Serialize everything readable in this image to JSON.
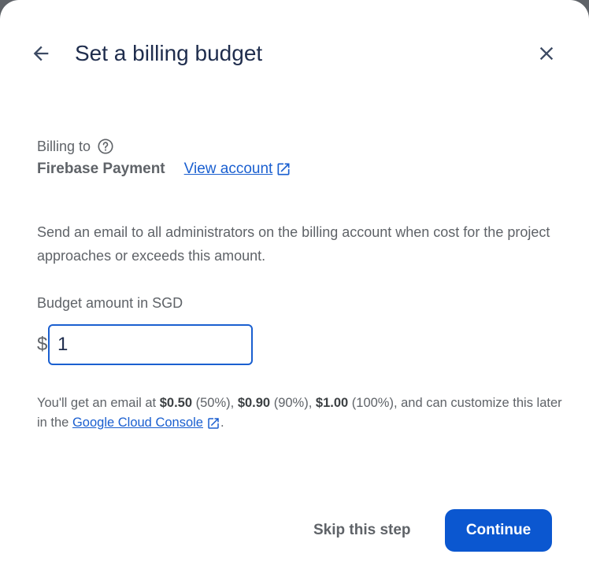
{
  "dialog": {
    "title": "Set a billing budget"
  },
  "billing": {
    "label": "Billing to",
    "account_name": "Firebase Payment",
    "view_account_link": "View account"
  },
  "description": "Send an email to all administrators on the billing account when cost for the project approaches or exceeds this amount.",
  "budget": {
    "label": "Budget amount in SGD",
    "currency_symbol": "$",
    "value": "1"
  },
  "info": {
    "prefix": "You'll get an email at ",
    "t1_amount": "$0.50",
    "t1_pct": " (50%), ",
    "t2_amount": "$0.90",
    "t2_pct": " (90%), ",
    "t3_amount": "$1.00",
    "t3_pct": " (100%), and can customize this later in the ",
    "console_link": "Google Cloud Console",
    "suffix": "."
  },
  "actions": {
    "skip_label": "Skip this step",
    "continue_label": "Continue"
  },
  "colors": {
    "accent": "#0b57d0",
    "link": "#1a5fd0",
    "title": "#1f2d4d",
    "body_text": "#5f6368"
  }
}
